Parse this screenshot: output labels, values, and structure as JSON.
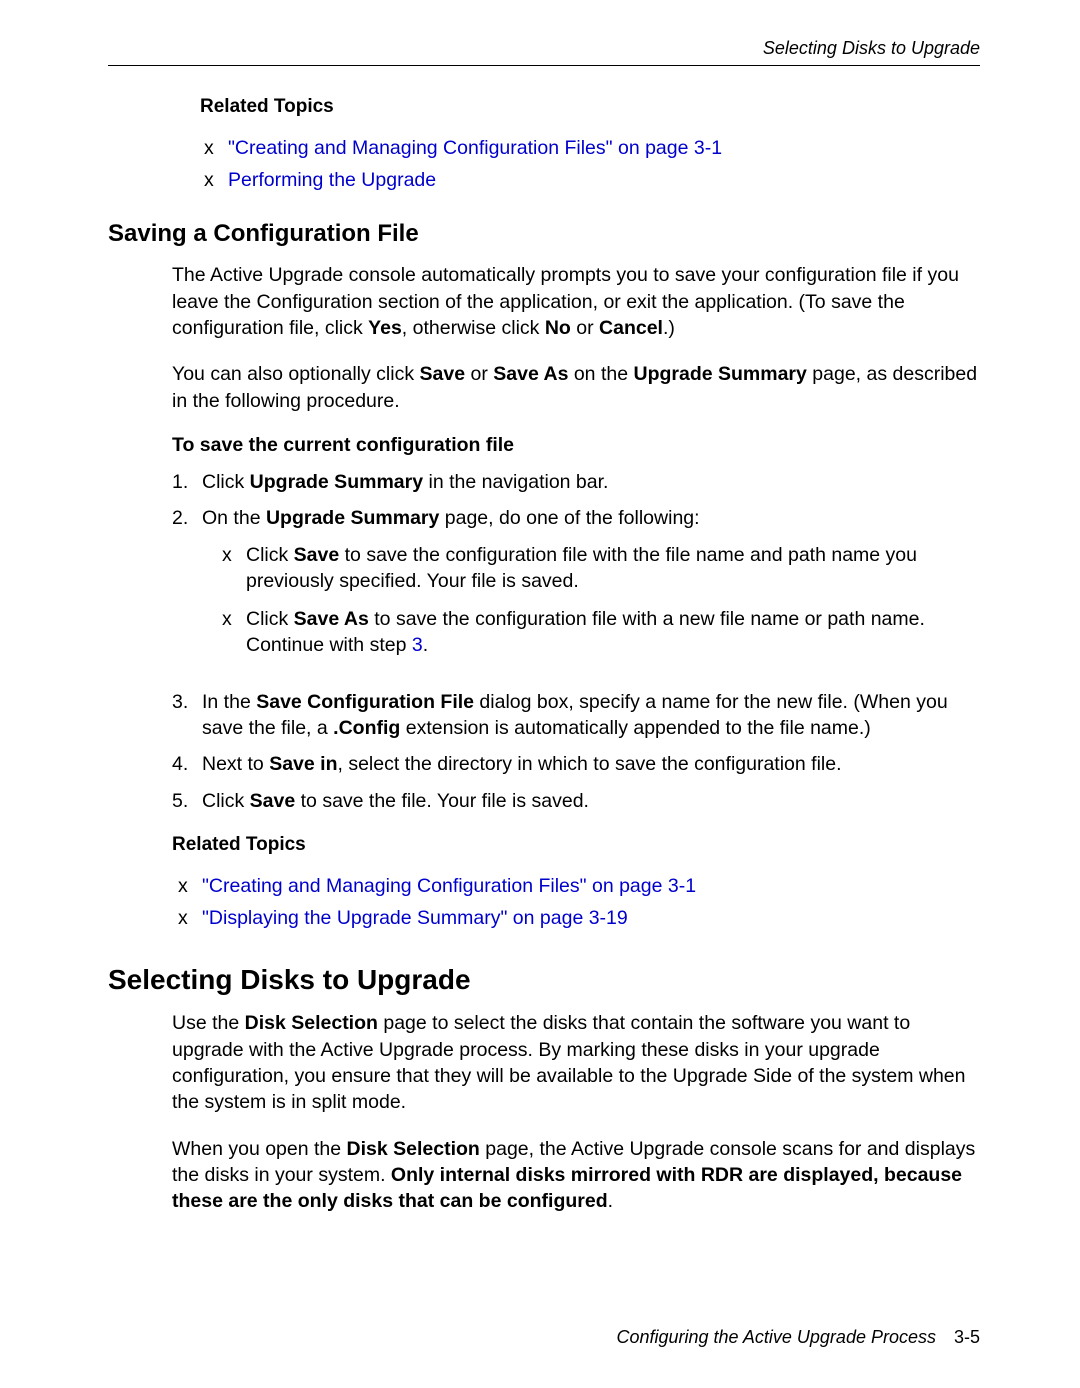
{
  "header": {
    "running_title": "Selecting Disks to Upgrade"
  },
  "section1": {
    "related_topics_label": "Related Topics",
    "link1": "\"Creating and Managing Configuration Files\" on page 3-1",
    "link2": "Performing the Upgrade"
  },
  "section2": {
    "heading": "Saving a Configuration File",
    "para1_a": "The Active Upgrade console automatically prompts you to save your configuration file if you leave the Configuration section of the application, or exit the application. (To save the configuration file, click ",
    "para1_b": "Yes",
    "para1_c": ", otherwise click ",
    "para1_d": "No",
    "para1_e": " or ",
    "para1_f": "Cancel",
    "para1_g": ".)",
    "para2_a": "You can also optionally click ",
    "para2_b": "Save",
    "para2_c": " or ",
    "para2_d": "Save As",
    "para2_e": " on the ",
    "para2_f": "Upgrade Summary",
    "para2_g": " page, as described in the following procedure.",
    "subheading": "To save the current configuration file",
    "step1_a": "Click ",
    "step1_b": "Upgrade Summary",
    "step1_c": " in the navigation bar.",
    "step2_a": "On the ",
    "step2_b": "Upgrade Summary",
    "step2_c": " page, do one of the following:",
    "step2_bullet1_a": "Click ",
    "step2_bullet1_b": "Save",
    "step2_bullet1_c": " to save the configuration file with the file name and path name you previously specified. Your file is saved.",
    "step2_bullet2_a": "Click ",
    "step2_bullet2_b": "Save As",
    "step2_bullet2_c": " to save the configuration file with a new file name or path name. Continue with step ",
    "step2_bullet2_link": "3",
    "step2_bullet2_d": ".",
    "step3_a": "In the ",
    "step3_b": "Save Configuration File",
    "step3_c": " dialog box, specify a name for the new file. (When you save the file, a ",
    "step3_d": ".Config",
    "step3_e": " extension is automatically appended to the file name.)",
    "step4_a": "Next to ",
    "step4_b": "Save in",
    "step4_c": ", select the directory in which to save the configuration file.",
    "step5_a": "Click ",
    "step5_b": "Save",
    "step5_c": " to save the file. Your file is saved.",
    "related_topics_label": "Related Topics",
    "rt_link1": "\"Creating and Managing Configuration Files\" on page 3-1",
    "rt_link2": "\"Displaying the Upgrade Summary\" on page 3-19"
  },
  "section3": {
    "heading": "Selecting Disks to Upgrade",
    "para1_a": "Use the ",
    "para1_b": "Disk Selection",
    "para1_c": " page to select the disks that contain the software you want to upgrade with the Active Upgrade process. By marking these disks in your upgrade configuration, you ensure that they will be available to the Upgrade Side of the system when the system is in split mode.",
    "para2_a": "When you open the ",
    "para2_b": "Disk Selection",
    "para2_c": " page, the Active Upgrade console scans for and displays the disks in your system. ",
    "para2_d": "Only internal disks mirrored with RDR are displayed, because these are the only disks that can be configured",
    "para2_e": "."
  },
  "footer": {
    "text": "Configuring the Active Upgrade Process",
    "page": "3-5"
  }
}
